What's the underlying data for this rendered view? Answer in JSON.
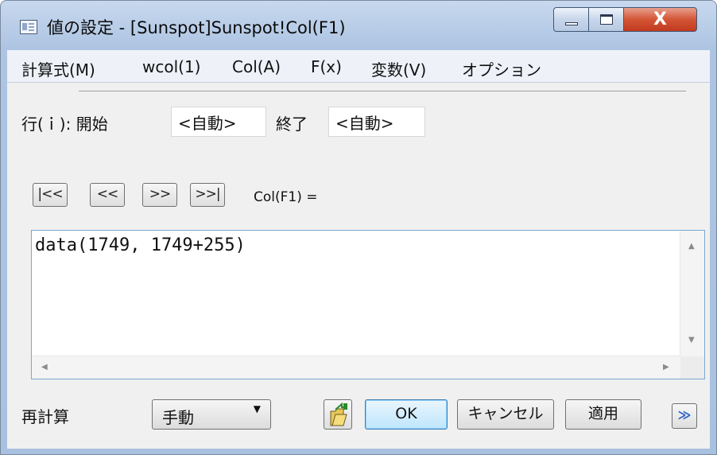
{
  "window": {
    "title": "値の設定 - [Sunspot]Sunspot!Col(F1)",
    "close_label": "X"
  },
  "menu": {
    "items": [
      "計算式(M)",
      "wcol(1)",
      "Col(A)",
      "F(x)",
      "変数(V)",
      "オプション"
    ]
  },
  "row_range": {
    "label": "行(ｉ): 開始",
    "start_value": "<自動>",
    "end_label": "終了",
    "end_value": "<自動>"
  },
  "nav": {
    "first": "|<<",
    "prev": "<<",
    "next": ">>",
    "last": ">>|",
    "column_label": "Col(F1) ="
  },
  "formula": {
    "text": "data(1749, 1749+255)"
  },
  "footer": {
    "recalc_label": "再計算",
    "recalc_mode": "手動",
    "ok": "OK",
    "cancel": "キャンセル",
    "apply": "適用"
  }
}
